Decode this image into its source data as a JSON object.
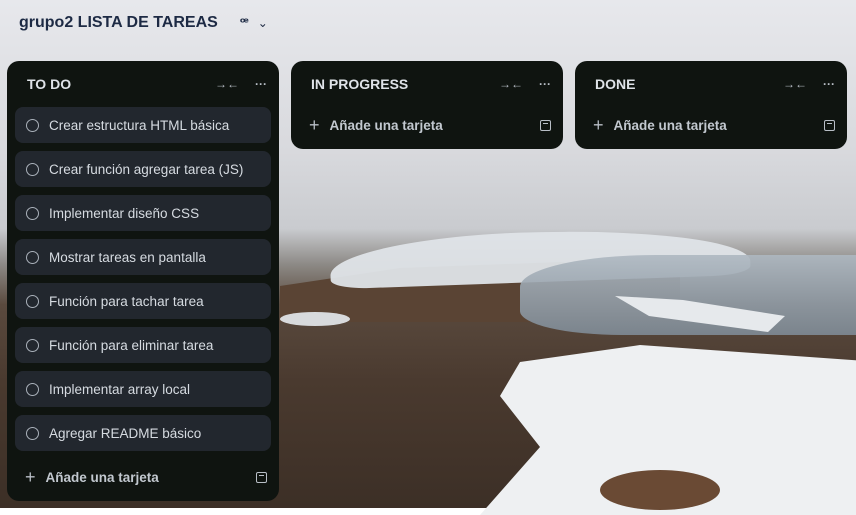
{
  "board": {
    "title": "grupo2 LISTA DE TAREAS",
    "view_icon": "board-view-icon",
    "view_glyph": "ꟹ",
    "chevron": "⌄"
  },
  "lists": [
    {
      "title": "TO DO",
      "collapse_glyph": "→←",
      "menu_glyph": "···",
      "cards": [
        "Crear estructura HTML básica",
        "Crear función agregar tarea (JS)",
        "Implementar diseño CSS",
        "Mostrar tareas en pantalla",
        "Función para tachar tarea",
        "Función para eliminar tarea",
        "Implementar array local",
        "Agregar README básico"
      ],
      "add_label": "Añade una tarjeta"
    },
    {
      "title": "IN PROGRESS",
      "collapse_glyph": "→←",
      "menu_glyph": "···",
      "cards": [],
      "add_label": "Añade una tarjeta"
    },
    {
      "title": "DONE",
      "collapse_glyph": "→←",
      "menu_glyph": "···",
      "cards": [],
      "add_label": "Añade una tarjeta"
    }
  ],
  "add_glyph": "+"
}
